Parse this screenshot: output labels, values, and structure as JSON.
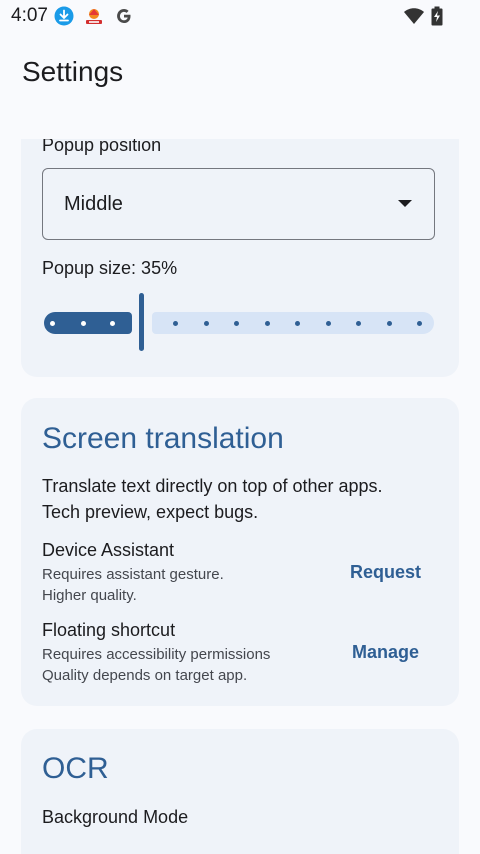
{
  "status_bar": {
    "time": "4:07",
    "icons": [
      "download-icon",
      "notification-app-icon",
      "google-g-icon",
      "wifi-icon",
      "battery-charging-icon"
    ]
  },
  "app_bar": {
    "title": "Settings"
  },
  "popup": {
    "position_label": "Popup position",
    "position_value": "Middle",
    "size_label": "Popup size: 35%",
    "size_percent": 35
  },
  "screen_translation": {
    "title": "Screen translation",
    "description_line1": "Translate text directly on top of other apps.",
    "description_line2": "Tech preview, expect bugs.",
    "device_assistant": {
      "title": "Device Assistant",
      "sub1": "Requires assistant gesture.",
      "sub2": "Higher quality.",
      "action": "Request"
    },
    "floating_shortcut": {
      "title": "Floating shortcut",
      "sub1": "Requires accessibility permissions",
      "sub2": "Quality depends on target app.",
      "action": "Manage"
    }
  },
  "ocr": {
    "title": "OCR",
    "background_mode_label": "Background Mode"
  },
  "colors": {
    "accent": "#2f5f94",
    "card_bg": "#eff3f9",
    "page_bg": "#f9fafd",
    "slider_inactive": "#d7e4f6"
  }
}
